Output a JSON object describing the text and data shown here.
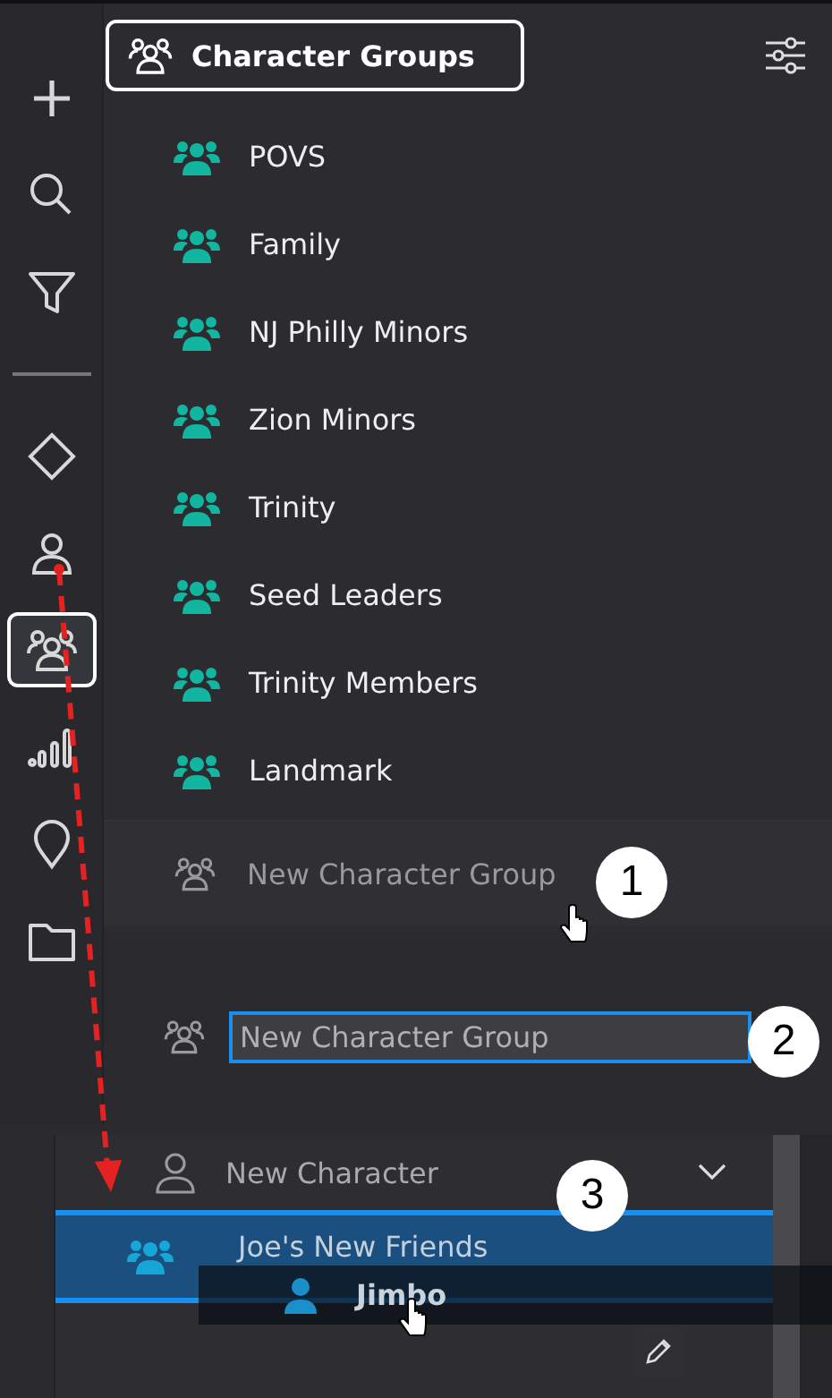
{
  "sidebar": {
    "items": [
      {
        "kind": "add",
        "selected": false
      },
      {
        "kind": "search",
        "selected": false
      },
      {
        "kind": "filter",
        "selected": false
      },
      {
        "kind": "divider",
        "selected": false
      },
      {
        "kind": "diamond",
        "selected": false
      },
      {
        "kind": "person",
        "selected": false
      },
      {
        "kind": "group",
        "selected": true
      },
      {
        "kind": "signal",
        "selected": false
      },
      {
        "kind": "pin",
        "selected": false
      },
      {
        "kind": "folder",
        "selected": false
      }
    ]
  },
  "header": {
    "title": "Character Groups"
  },
  "groups": [
    {
      "name": "POVS"
    },
    {
      "name": "Family"
    },
    {
      "name": "NJ Philly Minors"
    },
    {
      "name": "Zion Minors"
    },
    {
      "name": "Trinity"
    },
    {
      "name": "Seed Leaders"
    },
    {
      "name": "Trinity Members"
    },
    {
      "name": "Landmark"
    }
  ],
  "new_group": {
    "label": "New Character Group"
  },
  "name_field": {
    "value": "New Character Group"
  },
  "character_panel": {
    "new_character": "New Character",
    "group": "Joe's New Friends",
    "dragged_character": "Jimbo"
  },
  "steps": [
    "1",
    "2",
    "3"
  ]
}
